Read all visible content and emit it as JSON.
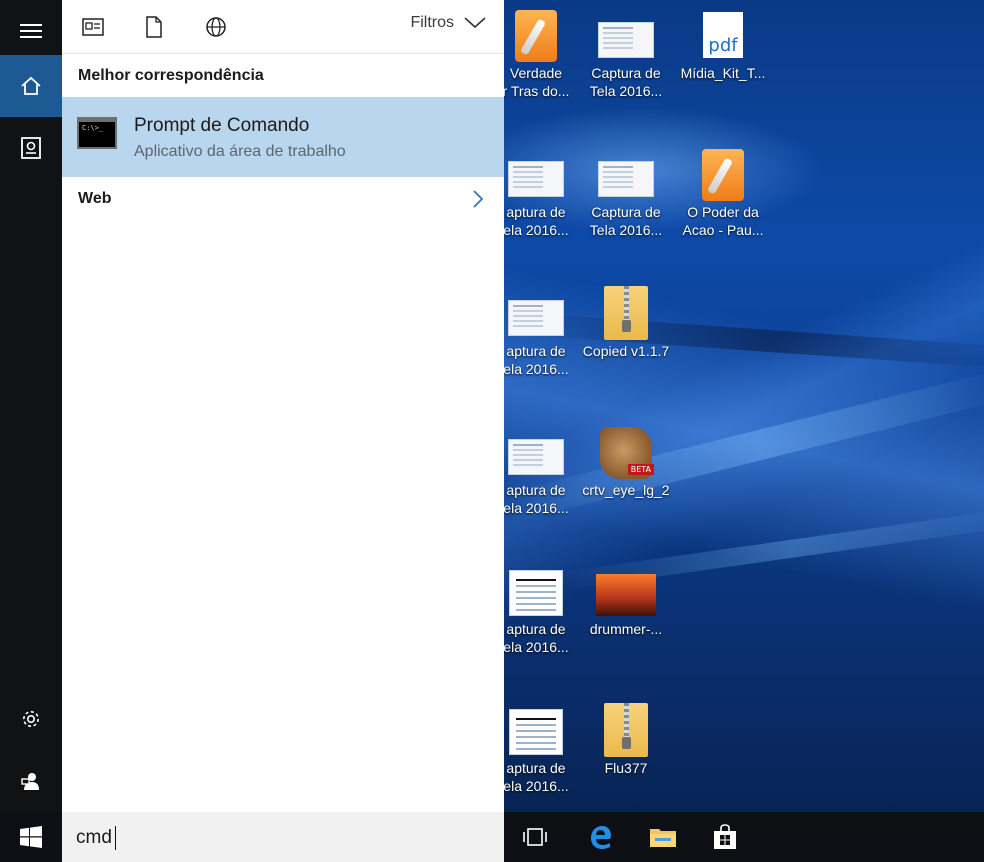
{
  "panel": {
    "toolbar": {
      "icons": [
        "apps-icon",
        "document-icon",
        "web-globe-icon"
      ],
      "filters_label": "Filtros"
    },
    "best_match_title": "Melhor correspondência",
    "best_match": {
      "name": "Prompt de Comando",
      "subtitle": "Aplicativo da área de trabalho",
      "icon": "command-prompt-icon"
    },
    "web_label": "Web"
  },
  "rail": {
    "items": [
      "menu-icon",
      "home-icon",
      "notebook-icon",
      "settings-icon",
      "feedback-icon"
    ],
    "active_item": "home-icon"
  },
  "search": {
    "value": "cmd"
  },
  "desktop": {
    "icons": [
      {
        "line1": "Verdade",
        "line2": "r Tras do...",
        "type": "pages"
      },
      {
        "line1": "Captura de",
        "line2": "Tela 2016...",
        "type": "screenshot"
      },
      {
        "line1": "Mídia_Kit_T...",
        "line2": "",
        "type": "pdf"
      },
      {
        "line1": "aptura de",
        "line2": "ela 2016...",
        "type": "screenshot"
      },
      {
        "line1": "Captura de",
        "line2": "Tela 2016...",
        "type": "screenshot"
      },
      {
        "line1": "O Poder da",
        "line2": "Acao - Pau...",
        "type": "pages"
      },
      {
        "line1": "aptura de",
        "line2": "ela 2016...",
        "type": "screenshot"
      },
      {
        "line1": "Copied v1.1.7",
        "line2": "",
        "type": "zip"
      },
      {
        "line1": "aptura de",
        "line2": "ela 2016...",
        "type": "screenshot"
      },
      {
        "line1": "crtv_eye_lg_2",
        "line2": "",
        "type": "rar"
      },
      {
        "line1": "aptura de",
        "line2": "ela 2016...",
        "type": "screenshot"
      },
      {
        "line1": "drummer-...",
        "line2": "",
        "type": "photo"
      },
      {
        "line1": "aptura de",
        "line2": "ela 2016...",
        "type": "screenshot"
      },
      {
        "line1": "Flu377",
        "line2": "",
        "type": "zip"
      }
    ]
  },
  "taskbar": {
    "icons": [
      "windows-start-icon",
      "task-view-icon",
      "edge-browser-icon",
      "file-explorer-icon",
      "store-icon"
    ]
  },
  "colors": {
    "accent": "#1d5a93",
    "selection": "#b9d6ef",
    "rail": "#111214",
    "taskbar": "#0d0f14",
    "search_box": "#f1f1f1"
  }
}
